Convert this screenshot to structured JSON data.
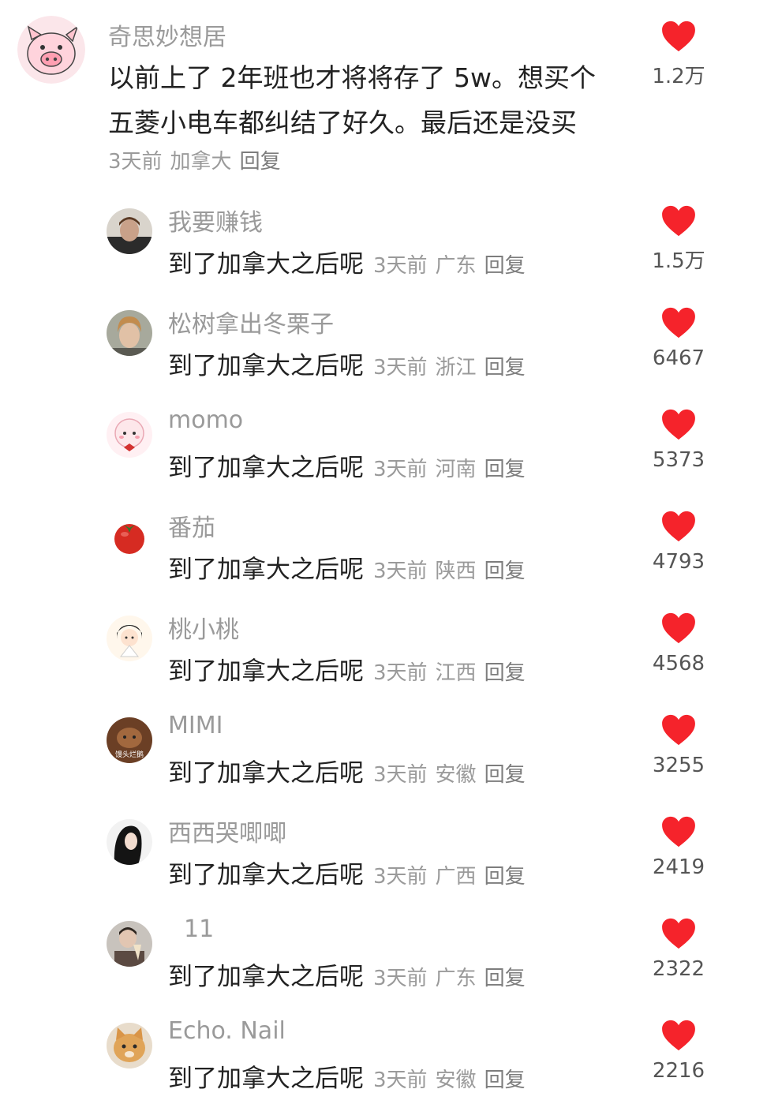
{
  "colors": {
    "heart": "#f5232b",
    "muted": "#9a9a9a",
    "text": "#222222"
  },
  "top_comment": {
    "username": "奇思妙想居",
    "text_line1": "以前上了 2年班也才将将存了 5w。想买个",
    "text_line2": "五菱小电车都纠结了好久。最后还是没买",
    "time": "3天前",
    "location": "加拿大",
    "reply_label": "回复",
    "likes": "1.2万",
    "avatar_icon": "pig-avatar-icon"
  },
  "replies": [
    {
      "username": "我要赚钱",
      "text": "到了加拿大之后呢",
      "time": "3天前",
      "location": "广东",
      "reply_label": "回复",
      "likes": "1.5万"
    },
    {
      "username": "松树拿出冬栗子",
      "text": "到了加拿大之后呢",
      "time": "3天前",
      "location": "浙江",
      "reply_label": "回复",
      "likes": "6467"
    },
    {
      "username": "momo",
      "text": "到了加拿大之后呢",
      "time": "3天前",
      "location": "河南",
      "reply_label": "回复",
      "likes": "5373"
    },
    {
      "username": "番茄",
      "text": "到了加拿大之后呢",
      "time": "3天前",
      "location": "陕西",
      "reply_label": "回复",
      "likes": "4793"
    },
    {
      "username": "桃小桃",
      "text": "到了加拿大之后呢",
      "time": "3天前",
      "location": "江西",
      "reply_label": "回复",
      "likes": "4568"
    },
    {
      "username": "MIMI",
      "text": "到了加拿大之后呢",
      "time": "3天前",
      "location": "安徽",
      "reply_label": "回复",
      "likes": "3255",
      "avatar_caption": "馒头烂鹅"
    },
    {
      "username": "西西哭唧唧",
      "text": "到了加拿大之后呢",
      "time": "3天前",
      "location": "广西",
      "reply_label": "回复",
      "likes": "2419"
    },
    {
      "username": "11",
      "text": "到了加拿大之后呢",
      "time": "3天前",
      "location": "广东",
      "reply_label": "回复",
      "likes": "2322"
    },
    {
      "username": "Echo. Nail",
      "text": "到了加拿大之后呢",
      "time": "3天前",
      "location": "安徽",
      "reply_label": "回复",
      "likes": "2216"
    }
  ]
}
